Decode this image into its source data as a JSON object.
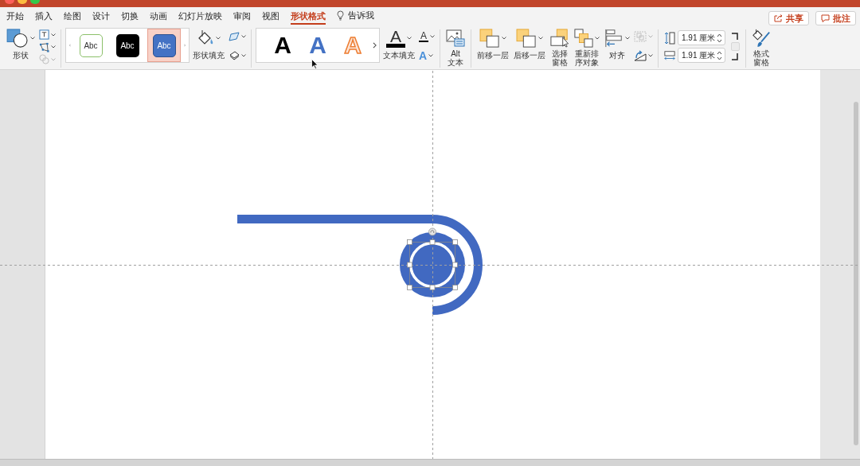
{
  "tabs": [
    {
      "label": "开始",
      "selected": false
    },
    {
      "label": "插入",
      "selected": false
    },
    {
      "label": "绘图",
      "selected": false
    },
    {
      "label": "设计",
      "selected": false
    },
    {
      "label": "切换",
      "selected": false
    },
    {
      "label": "动画",
      "selected": false
    },
    {
      "label": "幻灯片放映",
      "selected": false
    },
    {
      "label": "审阅",
      "selected": false
    },
    {
      "label": "视图",
      "selected": false
    },
    {
      "label": "形状格式",
      "selected": true
    }
  ],
  "tell_me": {
    "label": "告诉我"
  },
  "header_buttons": [
    {
      "kind": "share",
      "label": "共享"
    },
    {
      "kind": "comment",
      "label": "批注"
    }
  ],
  "ribbon": {
    "groups": [
      {
        "items": [
          {
            "kind": "shapes",
            "lines": [
              "形状"
            ]
          },
          {
            "kind": "tools",
            "tools": [
              {
                "kind": "text_box",
                "disabled": false
              },
              {
                "kind": "edit_shape",
                "disabled": false
              },
              {
                "kind": "merge_shapes",
                "disabled": true
              }
            ]
          }
        ]
      },
      {
        "items": [
          {
            "kind": "style_gallery",
            "styles": [
              {
                "kind": "outline",
                "label": "Abc",
                "selected": false
              },
              {
                "kind": "dark",
                "label": "Abc",
                "selected": false
              },
              {
                "kind": "blue",
                "label": "Abc",
                "selected": true
              }
            ]
          },
          {
            "kind": "shape_fill",
            "lines": [
              "形状填充"
            ]
          },
          {
            "kind": "tools",
            "tools": [
              {
                "kind": "shape_outline",
                "disabled": false
              },
              {
                "kind": "shape_effects",
                "disabled": false
              }
            ]
          }
        ]
      },
      {
        "items": [
          {
            "kind": "wordart_gallery",
            "styles": [
              {
                "kind": "solid",
                "label": "A"
              },
              {
                "kind": "blue",
                "label": "A"
              },
              {
                "kind": "outlined",
                "label": "A"
              }
            ]
          },
          {
            "kind": "text_fill",
            "glyph": "A",
            "lines": [
              "文本填充"
            ]
          },
          {
            "kind": "tools",
            "tools": [
              {
                "kind": "text_outline",
                "glyph": "A",
                "disabled": false
              },
              {
                "kind": "text_effects",
                "glyph": "A",
                "disabled": false
              }
            ]
          }
        ]
      },
      {
        "items": [
          {
            "kind": "alt_text",
            "lines": [
              "Alt",
              "文本"
            ]
          }
        ]
      },
      {
        "items": [
          {
            "kind": "bring_forward",
            "lines": [
              "前移一层"
            ]
          },
          {
            "kind": "send_backward",
            "lines": [
              "后移一层"
            ]
          },
          {
            "kind": "selection_pane",
            "lines": [
              "选择",
              "窗格"
            ]
          },
          {
            "kind": "reorder",
            "lines": [
              "重新排",
              "序对象"
            ]
          },
          {
            "kind": "align",
            "lines": [
              "对齐"
            ]
          },
          {
            "kind": "tools",
            "tools": [
              {
                "kind": "group",
                "disabled": true
              },
              {
                "kind": "rotate",
                "disabled": false
              }
            ]
          }
        ]
      },
      {
        "items": [
          {
            "kind": "size",
            "fields": [
              {
                "kind": "height",
                "value": "1.91 厘米"
              },
              {
                "kind": "width",
                "value": "1.91 厘米"
              }
            ],
            "lock": {
              "checked": false,
              "disabled": true
            }
          }
        ]
      },
      {
        "items": [
          {
            "kind": "format_pane",
            "lines": [
              "格式",
              "窗格"
            ]
          }
        ]
      }
    ]
  },
  "slide": {
    "shapes": [
      {
        "kind": "line",
        "selected": false
      },
      {
        "kind": "arc",
        "selected": false
      },
      {
        "kind": "ring",
        "selected": false
      },
      {
        "kind": "disc",
        "selected": true
      }
    ]
  }
}
